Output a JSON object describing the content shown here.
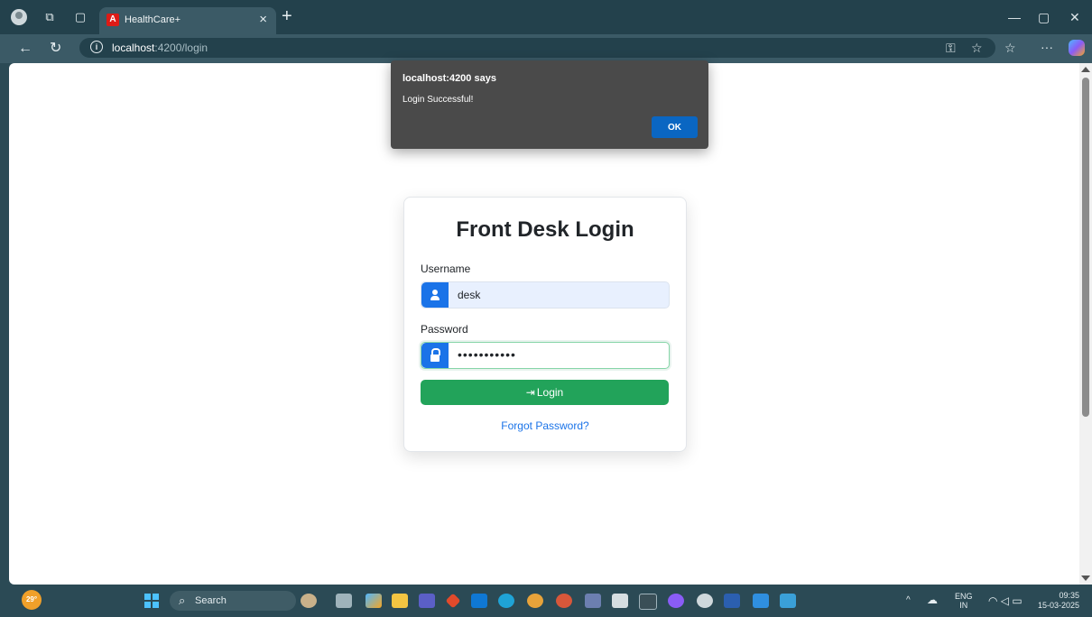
{
  "browser": {
    "tab_favicon": "A",
    "tab_title": "HealthCare+",
    "tab_close": "×",
    "new_tab": "+",
    "url_host": "localhost",
    "url_path": ":4200/login"
  },
  "alert": {
    "title": "localhost:4200 says",
    "message": "Login Successful!",
    "ok_label": "OK"
  },
  "login": {
    "title": "Front Desk Login",
    "username_label": "Username",
    "username_value": "desk",
    "password_label": "Password",
    "password_value": "•••••••••••",
    "login_label": "Login",
    "forgot_label": "Forgot Password?"
  },
  "taskbar": {
    "weather_temp": "29°",
    "search_text": "Search",
    "lang_line1": "ENG",
    "lang_line2": "IN",
    "time": "09:35",
    "date": "15-03-2025"
  },
  "colors": {
    "frame": "#2b4a55",
    "primary": "#1a73e8",
    "success": "#22a35a",
    "dialog": "#4a4a4a"
  }
}
